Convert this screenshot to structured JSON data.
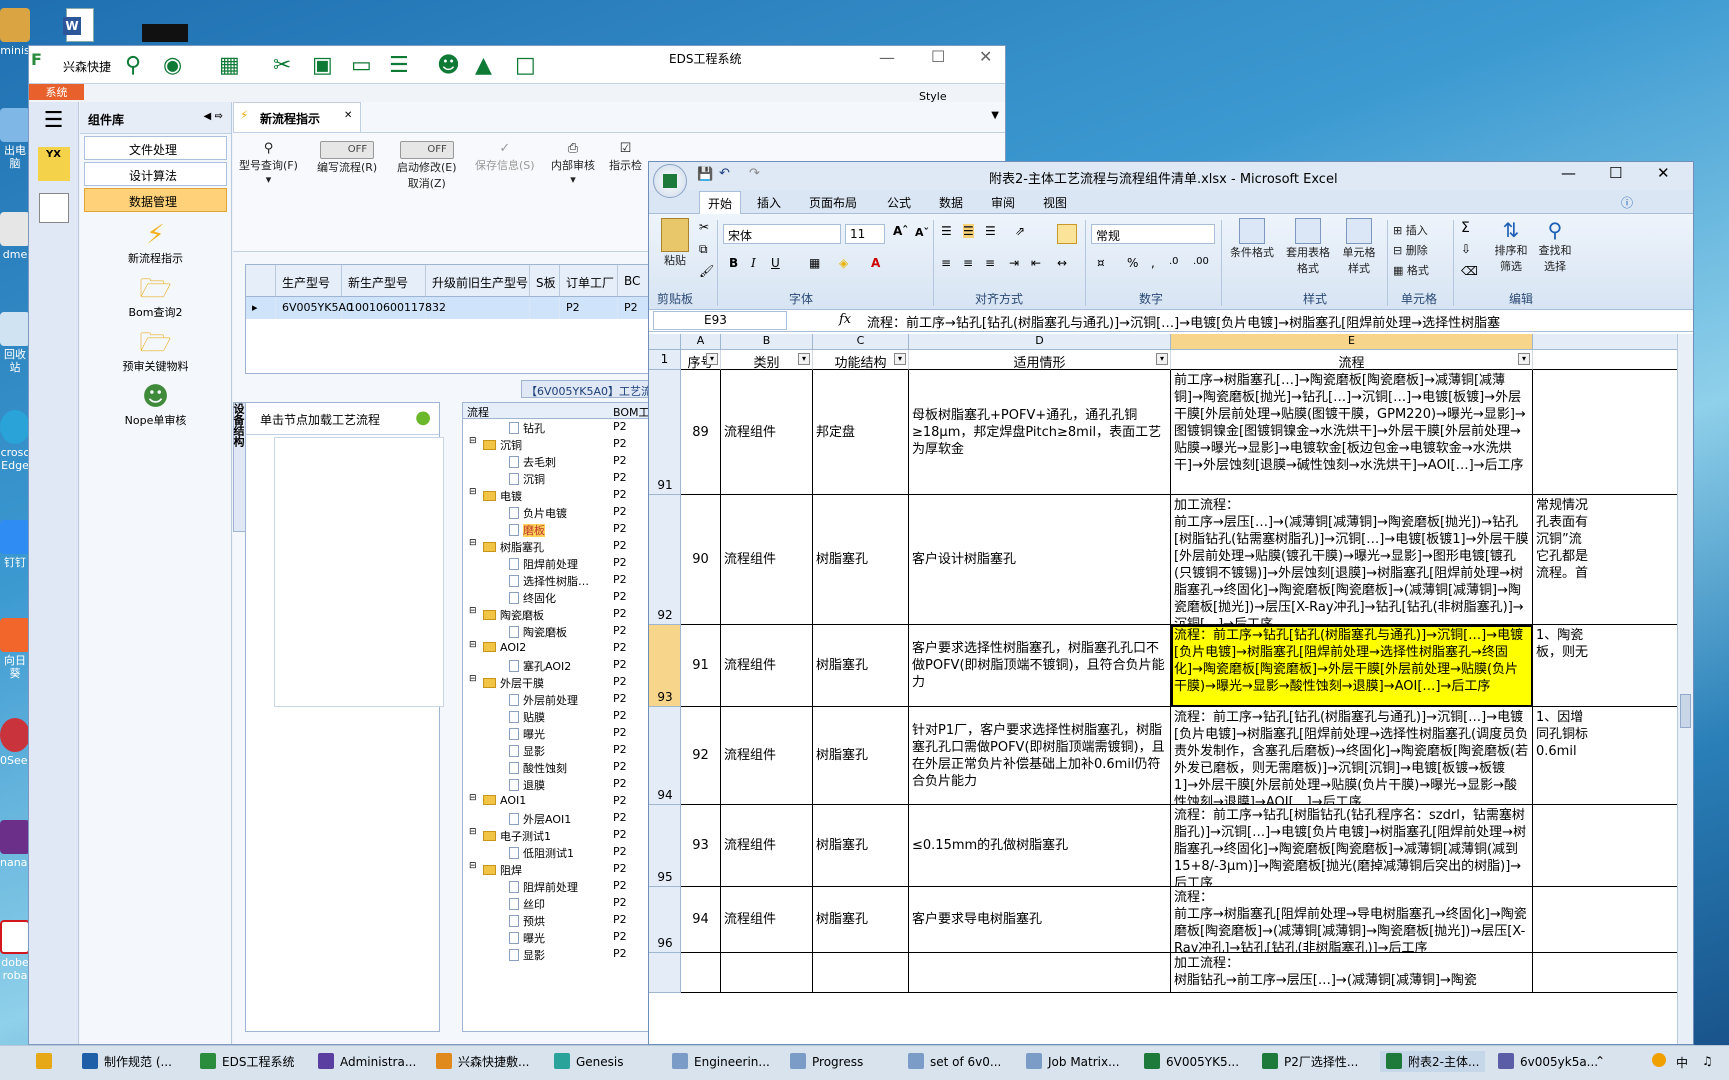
{
  "desktop": {
    "icons": [
      {
        "label": "minis"
      },
      {
        "label": "出电脑"
      },
      {
        "label": "dme"
      },
      {
        "label": "回收站"
      },
      {
        "label": "crosc Edge"
      },
      {
        "label": "钉钉"
      },
      {
        "label": "向日葵"
      },
      {
        "label": "0See."
      },
      {
        "label": "nanag"
      },
      {
        "label": "dobe roba"
      }
    ]
  },
  "eds": {
    "title": "EDS工程系统",
    "quick_access_label": "兴森快捷",
    "ribbon_tab": "系统",
    "style_label": "Style",
    "nav": {
      "header": "组件库",
      "rows": [
        {
          "label": "文件处理"
        },
        {
          "label": "设计算法"
        },
        {
          "label": "数据管理"
        }
      ],
      "big": [
        {
          "label": "新流程指示"
        },
        {
          "label": "Bom查询2"
        },
        {
          "label": "预审关键物料"
        },
        {
          "label": "Nope单审核"
        }
      ]
    },
    "doc_tab": "新流程指示",
    "toolbar": {
      "model_query": "型号查询(F)",
      "edit_flow": "编写流程(R)",
      "start_modify": "启动修改(E)",
      "cancel": "取消(Z)",
      "save_info": "保存信息(S)",
      "internal_review": "内部审核",
      "instruct_check": "指示检",
      "off1": "OFF",
      "off2": "OFF"
    },
    "grid": {
      "headers": [
        "生产型号",
        "新生产型号",
        "升级前旧生产型号",
        "S板",
        "订单工厂",
        "BC"
      ],
      "row": [
        "6V005YK5A0",
        "10010600117832",
        "",
        "",
        "P2",
        "P2"
      ]
    },
    "process_tab": "【6V005YK5A0】工艺流程",
    "vertical_tab": "设备结构",
    "process_hint": "单击节点加载工艺流程",
    "tree_header": {
      "col1": "流程",
      "col2": "BOM工厂"
    },
    "tree": [
      {
        "t": "钻孔",
        "lvl": 2,
        "p": "P2"
      },
      {
        "t": "沉铜",
        "lvl": 1,
        "p": "P2"
      },
      {
        "t": "去毛刺",
        "lvl": 2,
        "p": "P2"
      },
      {
        "t": "沉铜",
        "lvl": 2,
        "p": "P2"
      },
      {
        "t": "电镀",
        "lvl": 1,
        "p": "P2"
      },
      {
        "t": "负片电镀",
        "lvl": 2,
        "p": "P2"
      },
      {
        "t": "磨板",
        "lvl": 2,
        "p": "P2",
        "sel": true
      },
      {
        "t": "树脂塞孔",
        "lvl": 1,
        "p": "P2"
      },
      {
        "t": "阻焊前处理",
        "lvl": 2,
        "p": "P2"
      },
      {
        "t": "选择性树脂…",
        "lvl": 2,
        "p": "P2"
      },
      {
        "t": "终固化",
        "lvl": 2,
        "p": "P2"
      },
      {
        "t": "陶瓷磨板",
        "lvl": 1,
        "p": "P2"
      },
      {
        "t": "陶瓷磨板",
        "lvl": 2,
        "p": "P2"
      },
      {
        "t": "AOI2",
        "lvl": 1,
        "p": "P2"
      },
      {
        "t": "塞孔AOI2",
        "lvl": 2,
        "p": "P2"
      },
      {
        "t": "外层干膜",
        "lvl": 1,
        "p": "P2"
      },
      {
        "t": "外层前处理",
        "lvl": 2,
        "p": "P2"
      },
      {
        "t": "贴膜",
        "lvl": 2,
        "p": "P2"
      },
      {
        "t": "曝光",
        "lvl": 2,
        "p": "P2"
      },
      {
        "t": "显影",
        "lvl": 2,
        "p": "P2"
      },
      {
        "t": "酸性蚀刻",
        "lvl": 2,
        "p": "P2"
      },
      {
        "t": "退膜",
        "lvl": 2,
        "p": "P2"
      },
      {
        "t": "AOI1",
        "lvl": 1,
        "p": "P2"
      },
      {
        "t": "外层AOI1",
        "lvl": 2,
        "p": "P2"
      },
      {
        "t": "电子测试1",
        "lvl": 1,
        "p": "P2"
      },
      {
        "t": "低阻测试1",
        "lvl": 2,
        "p": "P2"
      },
      {
        "t": "阻焊",
        "lvl": 1,
        "p": "P2"
      },
      {
        "t": "阻焊前处理",
        "lvl": 2,
        "p": "P2"
      },
      {
        "t": "丝印",
        "lvl": 2,
        "p": "P2"
      },
      {
        "t": "预烘",
        "lvl": 2,
        "p": "P2"
      },
      {
        "t": "曝光",
        "lvl": 2,
        "p": "P2"
      },
      {
        "t": "显影",
        "lvl": 2,
        "p": "P2"
      }
    ]
  },
  "excel": {
    "title": "附表2-主体工艺流程与流程组件清单.xlsx - Microsoft Excel",
    "tabs": [
      "开始",
      "插入",
      "页面布局",
      "公式",
      "数据",
      "审阅",
      "视图"
    ],
    "ribbon": {
      "paste": "粘贴",
      "clipboard": "剪贴板",
      "font_name": "宋体",
      "font_size": "11",
      "font_group": "字体",
      "align_group": "对齐方式",
      "number_format": "常规",
      "number_group": "数字",
      "cond_format": "条件格式",
      "table_format": "套用表格格式",
      "cell_style": "单元格样式",
      "style_group": "样式",
      "insert": "插入",
      "delete": "删除",
      "format": "格式",
      "cells_group": "单元格",
      "sort": "排序和筛选",
      "find": "查找和选择",
      "edit_group": "编辑"
    },
    "name_box": "E93",
    "formula": "流程：前工序→钻孔[钻孔(树脂塞孔与通孔)]→沉铜[…]→电镀[负片电镀]→树脂塞孔[阻焊前处理→选择性树脂塞",
    "columns": [
      "A",
      "B",
      "C",
      "D",
      "E"
    ],
    "headers": [
      "序号",
      "类别",
      "功能结构",
      "适用情形",
      "流程"
    ],
    "rows": [
      {
        "rn": "91",
        "a": "89",
        "b": "流程组件",
        "c": "邦定盘",
        "d": "母板树脂塞孔+POFV+通孔，通孔孔铜≥18μm，邦定焊盘Pitch≥8mil，表面工艺为厚软金",
        "e": "前工序→树脂塞孔[…]→陶瓷磨板[陶瓷磨板]→减薄铜[减薄铜]→陶瓷磨板[抛光]→钻孔[…]→沉铜[…]→电镀[板镀]→外层干膜[外层前处理→贴膜(图镀干膜，GPM220)→曝光→显影]→图镀铜镍金[图镀铜镍金→水洗烘干]→外层干膜[外层前处理→贴膜→曝光→显影]→电镀软金[板边包金→电镀软金→水洗烘干]→外层蚀刻[退膜→碱性蚀刻→水洗烘干]→AOI[…]→后工序",
        "f": ""
      },
      {
        "rn": "92",
        "a": "90",
        "b": "流程组件",
        "c": "树脂塞孔",
        "d": "客户设计树脂塞孔",
        "e": "加工流程：\n前工序→层压[…]→(减薄铜[减薄铜]→陶瓷磨板[抛光])→钻孔[树脂钻孔(钻需塞树脂孔)]→沉铜[…]→电镀[板镀1]→外层干膜[外层前处理→贴膜(镀孔干膜)→曝光→显影]→图形电镀[镀孔(只镀铜不镀锡)]→外层蚀刻[退膜]→树脂塞孔[阻焊前处理→树脂塞孔→终固化]→陶瓷磨板[陶瓷磨板]→(减薄铜[减薄铜]→陶瓷磨板[抛光])→层压[X-Ray冲孔]→钻孔[钻孔(非树脂塞孔)]→沉铜[…]→后工序",
        "f": "常规情况\n孔表面有\n沉铜”流\n它孔都是\n流程。首"
      },
      {
        "rn": "93",
        "a": "91",
        "b": "流程组件",
        "c": "树脂塞孔",
        "d": "客户要求选择性树脂塞孔，树脂塞孔孔口不做POFV(即树脂顶端不镀铜)，且符合负片能力",
        "e": "流程：前工序→钻孔[钻孔(树脂塞孔与通孔)]→沉铜[…]→电镀[负片电镀]→树脂塞孔[阻焊前处理→选择性树脂塞孔→终固化]→陶瓷磨板[陶瓷磨板]→外层干膜[外层前处理→贴膜(负片干膜)→曝光→显影→酸性蚀刻→退膜]→AOI[…]→后工序",
        "f": "1、陶瓷\n板，则无"
      },
      {
        "rn": "94",
        "a": "92",
        "b": "流程组件",
        "c": "树脂塞孔",
        "d": "针对P1厂，客户要求选择性树脂塞孔，树脂塞孔孔口需做POFV(即树脂顶端需镀铜)，且在外层正常负片补偿基础上加补0.6mil仍符合负片能力",
        "e": "流程：前工序→钻孔[钻孔(树脂塞孔与通孔)]→沉铜[…]→电镀[负片电镀]→树脂塞孔[阻焊前处理→选择性树脂塞孔(调度员负责外发制作，含塞孔后磨板)→终固化]→陶瓷磨板[陶瓷磨板(若外发已磨板，则无需磨板)]→沉铜[沉铜]→电镀[板镀→板镀1]→外层干膜[外层前处理→贴膜(负片干膜)→曝光→显影→酸性蚀刻→退膜]→AOI[…]→后工序",
        "f": "1、因增\n同孔铜标\n0.6mil"
      },
      {
        "rn": "95",
        "a": "93",
        "b": "流程组件",
        "c": "树脂塞孔",
        "d": "≤0.15mm的孔做树脂塞孔",
        "e": "流程：前工序→钻孔[树脂钻孔(钻孔程序名：szdrl，钻需塞树脂孔)]→沉铜[…]→电镀[负片电镀]→树脂塞孔[阻焊前处理→树脂塞孔→终固化]→陶瓷磨板[陶瓷磨板]→减薄铜[减薄铜(减到15+8/-3μm)]→陶瓷磨板[抛光(磨掉减薄铜后突出的树脂)]→后工序",
        "f": ""
      },
      {
        "rn": "96",
        "a": "94",
        "b": "流程组件",
        "c": "树脂塞孔",
        "d": "客户要求导电树脂塞孔",
        "e": "流程：\n前工序→树脂塞孔[阻焊前处理→导电树脂塞孔→终固化]→陶瓷磨板[陶瓷磨板]→(减薄铜[减薄铜]→陶瓷磨板[抛光])→层压[X-Ray冲孔]→钻孔[钻孔(非树脂塞孔)]→后工序",
        "f": ""
      },
      {
        "rn": "",
        "a": "",
        "b": "",
        "c": "",
        "d": "",
        "e": "加工流程：\n树脂钻孔→前工序→层压[…]→(减薄铜[减薄铜]→陶瓷",
        "f": ""
      }
    ]
  },
  "taskbar": {
    "items": [
      {
        "label": ""
      },
      {
        "label": "制作规范 (..."
      },
      {
        "label": "EDS工程系统"
      },
      {
        "label": "Administra..."
      },
      {
        "label": "兴森快捷敷..."
      },
      {
        "label": "Genesis"
      },
      {
        "label": "Engineerin..."
      },
      {
        "label": "Progress"
      },
      {
        "label": "set of 6v0..."
      },
      {
        "label": "Job Matrix..."
      },
      {
        "label": "6V005YK5..."
      },
      {
        "label": "P2厂选择性..."
      },
      {
        "label": "附表2-主体..."
      },
      {
        "label": "6v005yk5a..."
      }
    ],
    "tray_lang": "中"
  }
}
